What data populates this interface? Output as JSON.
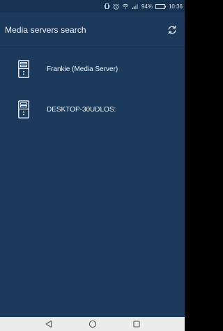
{
  "status_bar": {
    "battery_percent": "94%",
    "battery_level": 0.94,
    "time": "10:36",
    "icons": [
      "vibrate-icon",
      "alarm-icon",
      "wifi-icon",
      "signal-icon"
    ]
  },
  "app_bar": {
    "title": "Media servers search",
    "refresh_icon": "refresh-icon"
  },
  "servers": [
    {
      "name": "Frankie (Media Server)",
      "icon": "server-tower-icon"
    },
    {
      "name": "DESKTOP-30UDLOS:",
      "icon": "server-tower-icon"
    }
  ],
  "nav_bar": {
    "buttons": [
      "back-icon",
      "home-icon",
      "recents-icon"
    ]
  },
  "colors": {
    "background": "#1b3a5c",
    "status_bar": "#173250",
    "text": "#f2f5f8",
    "nav_bar": "#ececec"
  }
}
